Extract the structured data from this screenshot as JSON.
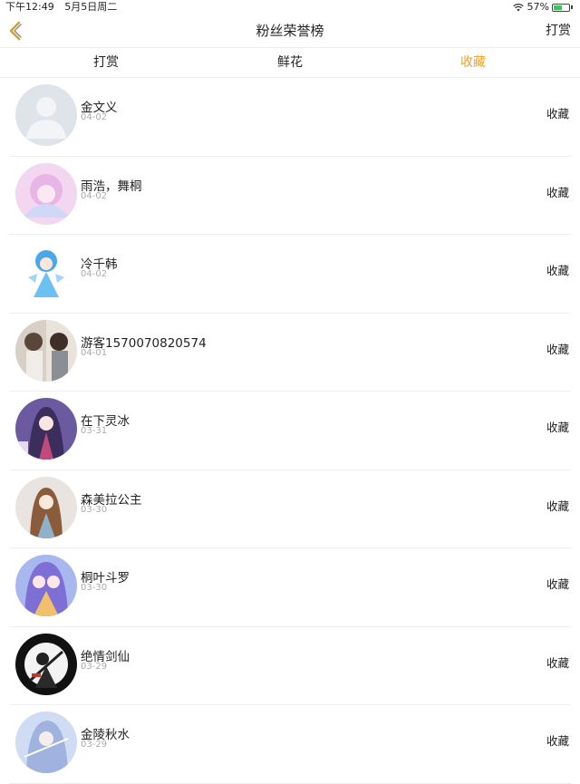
{
  "status_bar": {
    "time": "下午12:49",
    "date": "5月5日周二",
    "battery": "57%",
    "battery_level": 0.57
  },
  "nav": {
    "title": "粉丝荣誉榜",
    "right_label": "打赏",
    "back_icon": "chevron-left-icon"
  },
  "tabs": [
    {
      "label": "打赏"
    },
    {
      "label": "鲜花"
    },
    {
      "label": "收藏"
    }
  ],
  "active_tab": 2,
  "colors": {
    "accent": "#f0a020",
    "divider": "#eeeeee",
    "date_text": "#aaaaaa"
  },
  "fans": [
    {
      "name": "金文义",
      "date": "04-02",
      "action": "收藏",
      "avatar": "default-avatar-icon"
    },
    {
      "name": "雨浩，舞桐",
      "date": "04-02",
      "action": "收藏",
      "avatar": "anime-avatar"
    },
    {
      "name": "冷千韩",
      "date": "04-02",
      "action": "收藏",
      "avatar": "anime-avatar"
    },
    {
      "name": "游客1570070820574",
      "date": "04-01",
      "action": "收藏",
      "avatar": "photo-avatar"
    },
    {
      "name": "在下灵冰",
      "date": "03-31",
      "action": "收藏",
      "avatar": "anime-avatar"
    },
    {
      "name": "森美拉公主",
      "date": "03-30",
      "action": "收藏",
      "avatar": "anime-avatar"
    },
    {
      "name": "桐叶斗罗",
      "date": "03-30",
      "action": "收藏",
      "avatar": "anime-avatar"
    },
    {
      "name": "绝情剑仙",
      "date": "03-29",
      "action": "收藏",
      "avatar": "anime-avatar"
    },
    {
      "name": "金陵秋水",
      "date": "03-29",
      "action": "收藏",
      "avatar": "anime-avatar"
    }
  ]
}
